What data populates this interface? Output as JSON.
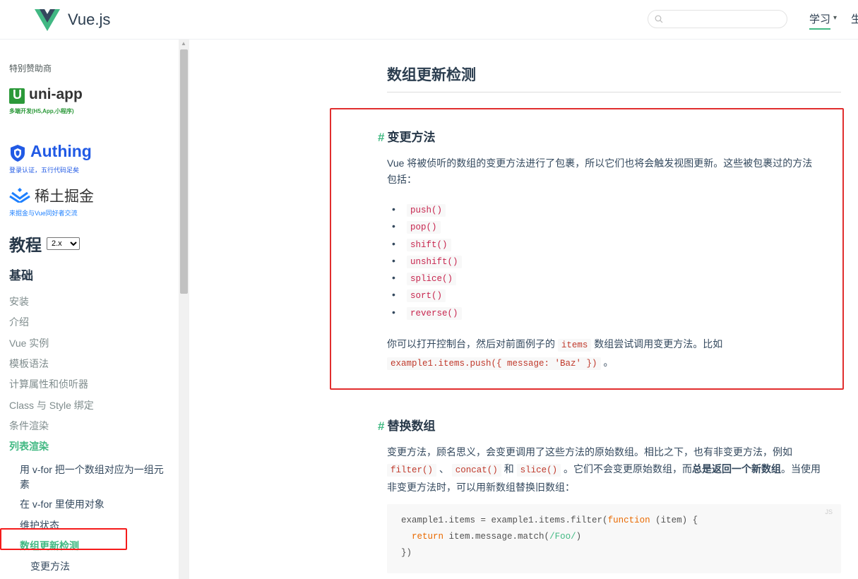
{
  "header": {
    "site_title": "Vue.js",
    "search_placeholder": "",
    "nav": {
      "learn": "学习",
      "learn_caret": "▾",
      "ecosystem": "生态系统"
    }
  },
  "sidebar": {
    "sponsor_label": "特别赞助商",
    "sponsors": [
      {
        "name": "uni-app",
        "tagline": "多端开发(H5,App,小程序)",
        "logo_letter": "U",
        "color": "#2b9939"
      },
      {
        "name": "Authing",
        "tagline": "登录认证，五行代码足矣",
        "color": "#215ae5"
      },
      {
        "name": "稀土掘金",
        "tagline": "来掘金与Vue同好者交流",
        "color": "#1e80ff"
      }
    ],
    "tutorial_title": "教程",
    "version_options": [
      "2.x"
    ],
    "version_selected": "2.x",
    "basics_title": "基础",
    "items": [
      "安装",
      "介绍",
      "Vue 实例",
      "模板语法",
      "计算属性和侦听器",
      "Class 与 Style 绑定",
      "条件渲染",
      "列表渲染"
    ],
    "subitems": [
      "用 v-for 把一个数组对应为一组元",
      "素",
      "在 v-for 里使用对象",
      "维护状态",
      "数组更新检测"
    ],
    "subsubitems": [
      "变更方法"
    ]
  },
  "content": {
    "page_title": "数组更新检测",
    "hash": "#",
    "section1": {
      "title": "变更方法",
      "intro_line1": "Vue 将被侦听的数组的变更方法进行了包裹，所以它们也将会触发视图更新。这些被包裹过的方法",
      "intro_line2": "包括：",
      "methods": [
        "push()",
        "pop()",
        "shift()",
        "unshift()",
        "splice()",
        "sort()",
        "reverse()"
      ],
      "outro_pre": "你可以打开控制台，然后对前面例子的",
      "outro_code1": "items",
      "outro_mid": "数组尝试调用变更方法。比如",
      "outro_code2": "example1.items.push({ message: 'Baz' })",
      "outro_end": "。"
    },
    "section2": {
      "title": "替换数组",
      "line1": "变更方法，顾名思义，会变更调用了这些方法的原始数组。相比之下，也有非变更方法，例如",
      "code_filter": "filter()",
      "sep1": "、",
      "code_concat": "concat()",
      "and": "和",
      "code_slice": "slice()",
      "line2_mid": "。它们不会变更原始数组，而",
      "line2_bold": "总是返回一个新数组",
      "line2_end": "。当使用",
      "line3": "非变更方法时，可以用新数组替换旧数组：",
      "code_lang": "JS",
      "code_l1_a": "example1.items = example1.items.filter(",
      "code_l1_kw": "function",
      "code_l1_b": " (item) {",
      "code_l2_kw": "return",
      "code_l2_a": " item.message.match(",
      "code_l2_rx": "/Foo/",
      "code_l2_b": ")",
      "code_l3": "})"
    }
  }
}
